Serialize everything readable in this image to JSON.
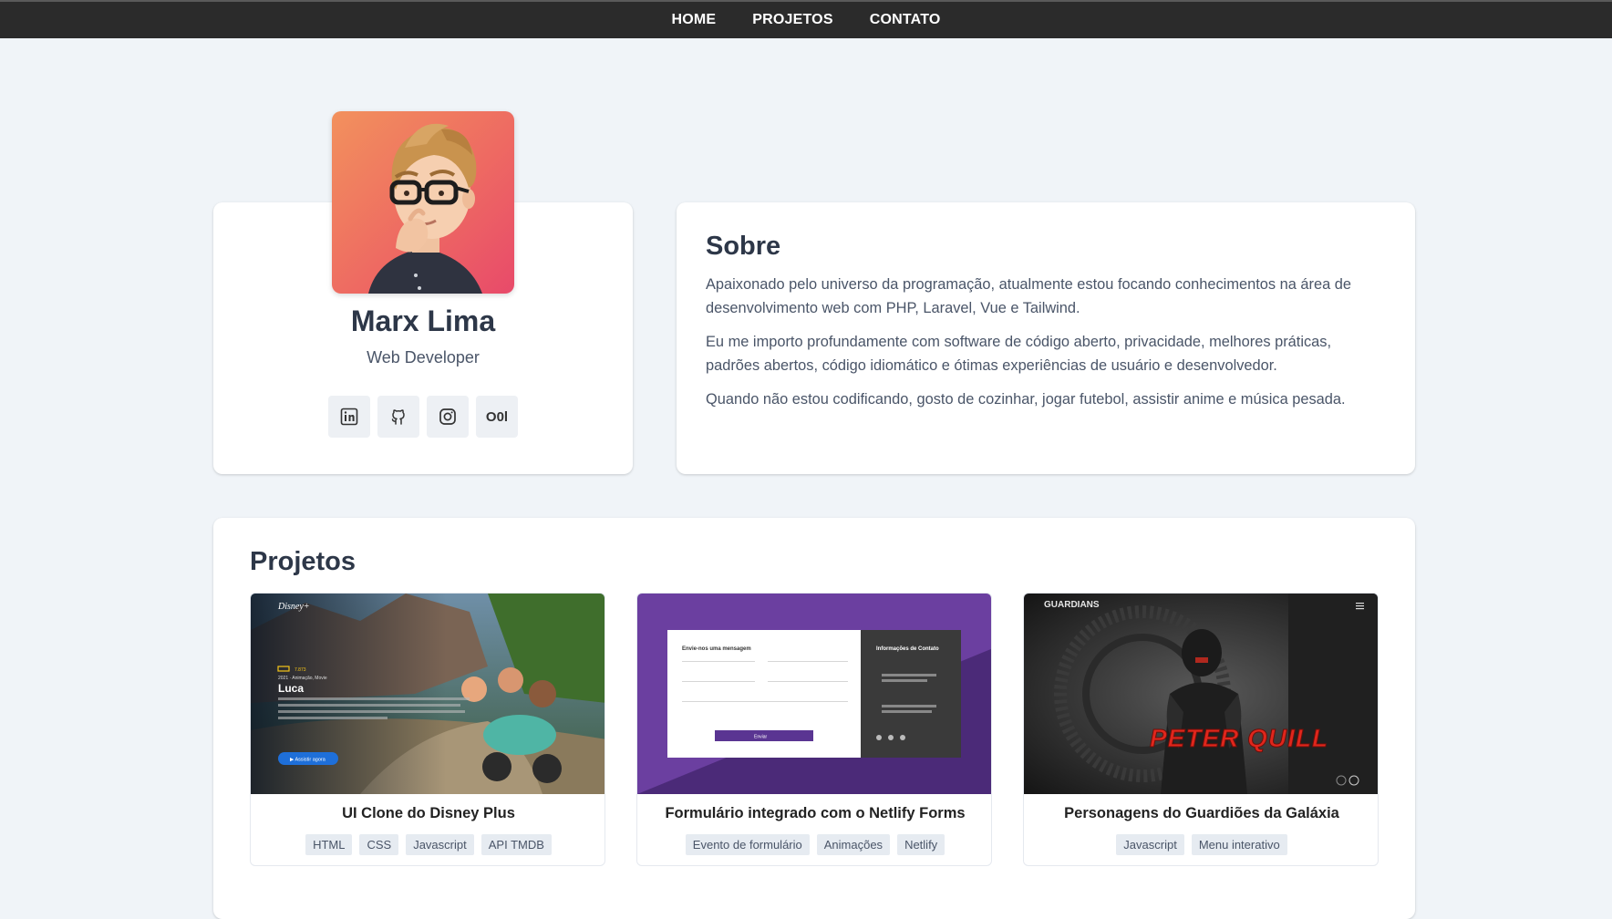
{
  "nav": {
    "items": [
      {
        "label": "HOME"
      },
      {
        "label": "PROJETOS"
      },
      {
        "label": "CONTATO"
      }
    ]
  },
  "profile": {
    "name": "Marx Lima",
    "role": "Web Developer",
    "socials": [
      {
        "icon": "linkedin-icon"
      },
      {
        "icon": "github-icon"
      },
      {
        "icon": "instagram-icon"
      },
      {
        "icon": "codepen-icon",
        "label": "O0l"
      }
    ]
  },
  "about": {
    "title": "Sobre",
    "paragraphs": [
      "Apaixonado pelo universo da programação, atualmente estou focando conhecimentos na área de desenvolvimento web com PHP, Laravel, Vue e Tailwind.",
      "Eu me importo profundamente com software de código aberto, privacidade, melhores práticas, padrões abertos, código idiomático e ótimas experiências de usuário e desenvolvedor.",
      "Quando não estou codificando, gosto de cozinhar, jogar futebol, assistir anime e música pesada."
    ]
  },
  "projects": {
    "title": "Projetos",
    "items": [
      {
        "title": "UI Clone do Disney Plus",
        "tags": [
          "HTML",
          "CSS",
          "Javascript",
          "API TMDB"
        ],
        "thumb": {
          "logo": "Disney+",
          "movie": "Luca",
          "meta": "2021 · Animação, Movie",
          "button": "Assistir agora"
        }
      },
      {
        "title": "Formulário integrado com o Netlify Forms",
        "tags": [
          "Evento de formulário",
          "Animações",
          "Netlify"
        ],
        "thumb": {
          "form_title": "Envie-nos uma mensagem",
          "contact_title": "Informações de Contato",
          "button": "Enviar"
        }
      },
      {
        "title": "Personagens do Guardiões da Galáxia",
        "tags": [
          "Javascript",
          "Menu interativo"
        ],
        "thumb": {
          "logo": "GUARDIANS",
          "hero": "PETER QUILL"
        }
      }
    ]
  },
  "colors": {
    "nav_bg": "#2b2b2b",
    "page_bg": "#f0f4f8",
    "avatar_gradient_start": "#f2915d",
    "avatar_gradient_end": "#e84a6a",
    "netlify_purple": "#6b3fa0",
    "quill_red": "#e0261c"
  }
}
